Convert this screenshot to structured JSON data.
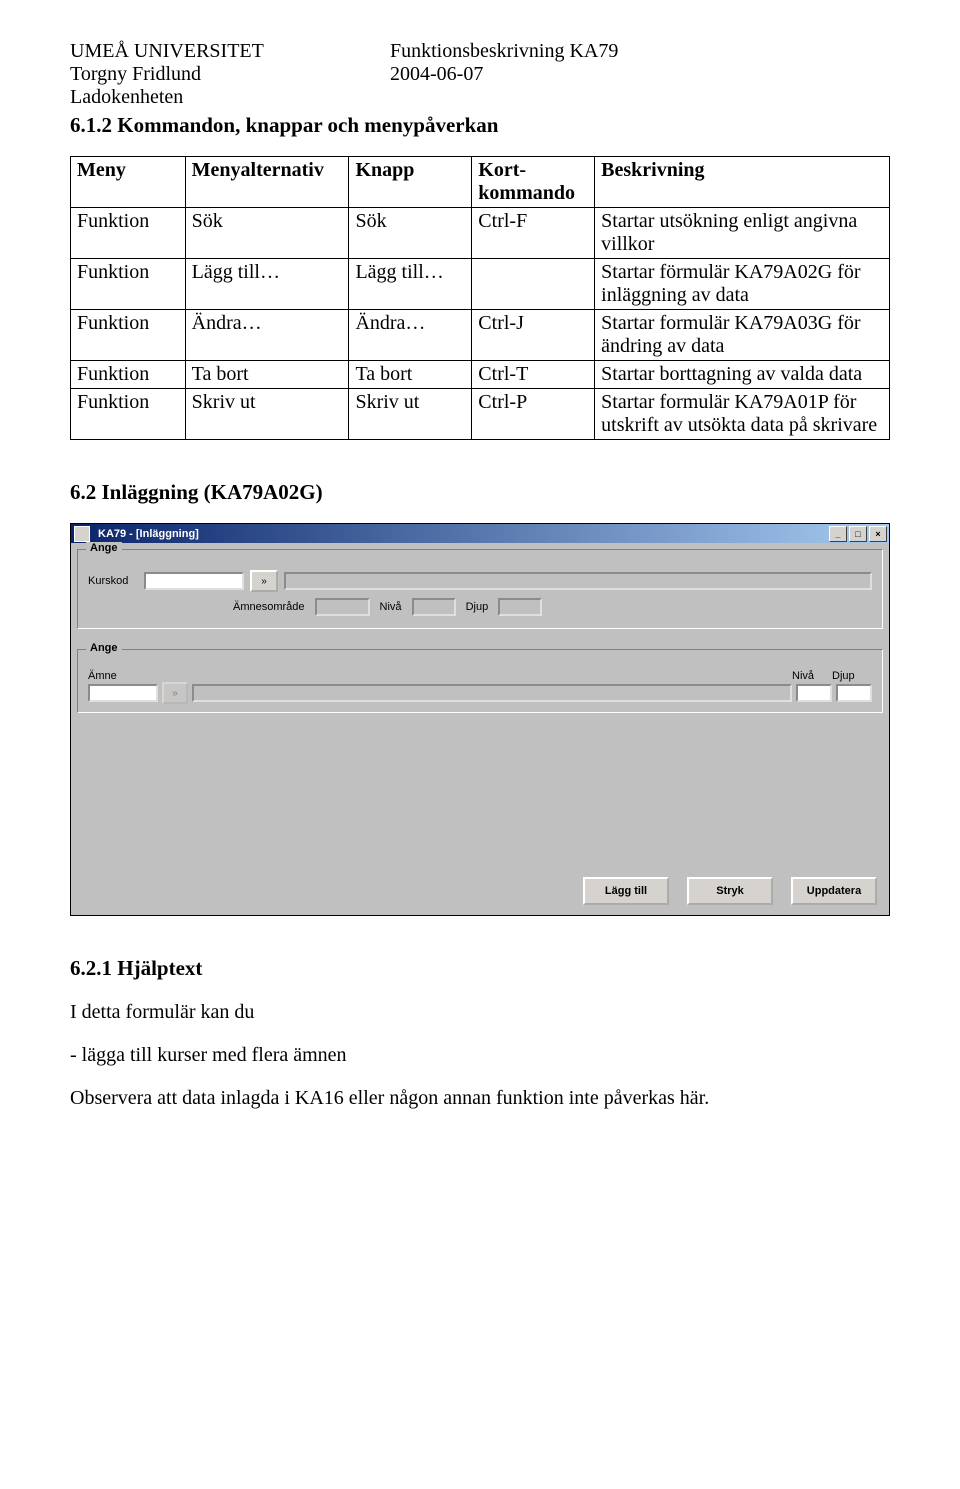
{
  "header": {
    "uni": "UMEÅ UNIVERSITET",
    "author": "Torgny Fridlund",
    "unit": "Ladokenheten",
    "doc_title": "Funktionsbeskrivning KA79",
    "date": "2004-06-07"
  },
  "section_612": "6.1.2  Kommandon, knappar och menypåverkan",
  "table_headers": {
    "meny": "Meny",
    "alt": "Menyalternativ",
    "knapp": "Knapp",
    "kort": "Kort-kommando",
    "besk": "Beskrivning"
  },
  "commands": [
    {
      "meny": "Funktion",
      "alt": "Sök",
      "knapp": "Sök",
      "kort": "Ctrl-F",
      "besk": "Startar utsökning enligt angivna villkor"
    },
    {
      "meny": "Funktion",
      "alt": "Lägg till…",
      "knapp": "Lägg till…",
      "kort": "",
      "besk": "Startar förmulär KA79A02G för inläggning av data"
    },
    {
      "meny": "Funktion",
      "alt": "Ändra…",
      "knapp": "Ändra…",
      "kort": "Ctrl-J",
      "besk": "Startar formulär KA79A03G för ändring av data"
    },
    {
      "meny": "Funktion",
      "alt": "Ta bort",
      "knapp": "Ta bort",
      "kort": "Ctrl-T",
      "besk": "Startar borttagning av valda data"
    },
    {
      "meny": "Funktion",
      "alt": "Skriv ut",
      "knapp": "Skriv ut",
      "kort": "Ctrl-P",
      "besk": "Startar formulär KA79A01P för utskrift av utsökta data på skrivare"
    }
  ],
  "section_62": "6.2  Inläggning  (KA79A02G)",
  "dialog": {
    "title": "KA79 - [Inläggning]",
    "group1_label": "Ange",
    "group2_label": "Ange",
    "labels": {
      "kurskod": "Kurskod",
      "amnesomrade": "Ämnesområde",
      "niva": "Nivå",
      "djup": "Djup",
      "amne": "Ämne"
    },
    "buttons": {
      "lagg_till": "Lägg till",
      "stryk": "Stryk",
      "uppdatera": "Uppdatera"
    },
    "lookup_glyph": "»"
  },
  "section_621": "6.2.1  Hjälptext",
  "help_intro": "I detta formulär kan du",
  "help_item": " - lägga till kurser med flera ämnen",
  "help_note": "Observera att data inlagda i KA16 eller någon annan funktion inte påverkas här."
}
